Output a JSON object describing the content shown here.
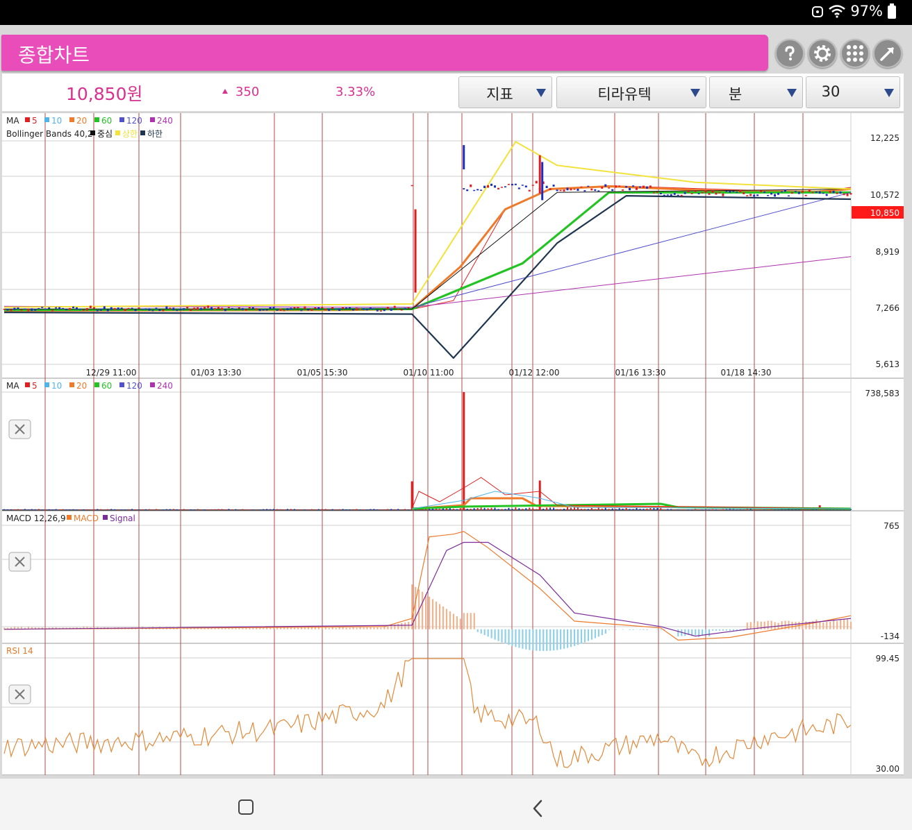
{
  "status_bar": {
    "battery": "97%"
  },
  "header": {
    "title": "종합차트"
  },
  "toolbar": {
    "help_icon": "question-circle-icon",
    "settings_icon": "gear-icon",
    "grid_icon": "grid-dots-icon",
    "expand_icon": "expand-arrow-icon"
  },
  "quote": {
    "price": "10,850원",
    "change": "350",
    "change_pct": "3.33%",
    "up_color": "#d9308f"
  },
  "dropdowns": {
    "indicator": "지표",
    "stock": "티라유텍",
    "period_unit": "분",
    "period_value": "30"
  },
  "colors": {
    "accent": "#e84db9",
    "up": "#e01e1e",
    "down": "#1b2fbf",
    "ma5": "#e02020",
    "ma10": "#4fb5e8",
    "ma20": "#ee7a2a",
    "ma60": "#22c322",
    "ma120": "#5050d0",
    "ma240": "#b030b0",
    "bb_mid": "#111111",
    "bb_upper": "#f2e23a",
    "bb_lower": "#1e3550",
    "macd": "#ee7a2a",
    "signal": "#7a2a9a",
    "rsi": "#e08a3a",
    "vline": "#b54a4a"
  },
  "legends": {
    "price_ma": {
      "label": "MA",
      "items": [
        "5",
        "10",
        "20",
        "60",
        "120",
        "240"
      ]
    },
    "bollinger": {
      "label": "Bollinger Bands 40,2",
      "items": [
        "중심",
        "상한",
        "하한"
      ]
    },
    "volume_ma": {
      "label": "MA",
      "items": [
        "5",
        "10",
        "20",
        "60",
        "120",
        "240"
      ]
    },
    "macd": {
      "label": "MACD 12,26,9",
      "items": [
        "MACD",
        "Signal"
      ]
    },
    "rsi": {
      "label": "RSI 14"
    }
  },
  "chart_data": [
    {
      "type": "candlestick",
      "panel": "price",
      "title": "",
      "x_ticks": [
        "12/29 11:00",
        "01/03 13:30",
        "01/05 15:30",
        "01/10 11:00",
        "01/12 12:00",
        "01/16 13:30",
        "01/18 14:30"
      ],
      "y_ticks": [
        "12,225",
        "10,572",
        "8,919",
        "7,266",
        "5,613"
      ],
      "ylim": [
        5613,
        12225
      ],
      "current_price_label": "10,850",
      "series": [
        {
          "name": "MA 5",
          "approx_path": [
            [
              0,
              7230
            ],
            [
              60,
              7220
            ],
            [
              118,
              7240
            ],
            [
              130,
              7500
            ],
            [
              145,
              10200
            ],
            [
              158,
              10800
            ],
            [
              175,
              10900
            ],
            [
              205,
              10800
            ],
            [
              235,
              10700
            ],
            [
              245,
              10850
            ]
          ]
        },
        {
          "name": "MA 20",
          "approx_path": [
            [
              0,
              7200
            ],
            [
              100,
              7220
            ],
            [
              118,
              7250
            ],
            [
              132,
              8500
            ],
            [
              145,
              10200
            ],
            [
              158,
              10800
            ],
            [
              175,
              10880
            ],
            [
              205,
              10750
            ],
            [
              235,
              10720
            ],
            [
              245,
              10800
            ]
          ]
        },
        {
          "name": "MA 60",
          "approx_path": [
            [
              0,
              7220
            ],
            [
              118,
              7250
            ],
            [
              150,
              8600
            ],
            [
              175,
              10700
            ],
            [
              205,
              10700
            ],
            [
              245,
              10700
            ]
          ]
        },
        {
          "name": "MA 120",
          "approx_path": [
            [
              0,
              7330
            ],
            [
              118,
              7300
            ],
            [
              245,
              10700
            ]
          ]
        },
        {
          "name": "MA 240",
          "approx_path": [
            [
              0,
              7330
            ],
            [
              118,
              7300
            ],
            [
              245,
              8800
            ]
          ]
        },
        {
          "name": "중심",
          "approx_path": [
            [
              0,
              7250
            ],
            [
              118,
              7250
            ],
            [
              160,
              10700
            ],
            [
              245,
              10800
            ]
          ]
        },
        {
          "name": "상한",
          "approx_path": [
            [
              0,
              7300
            ],
            [
              118,
              7400
            ],
            [
              148,
              12200
            ],
            [
              160,
              11500
            ],
            [
              200,
              11000
            ],
            [
              245,
              10800
            ]
          ]
        },
        {
          "name": "하한",
          "approx_path": [
            [
              0,
              7150
            ],
            [
              118,
              7100
            ],
            [
              130,
              5800
            ],
            [
              160,
              9200
            ],
            [
              180,
              10600
            ],
            [
              245,
              10500
            ]
          ]
        }
      ]
    },
    {
      "type": "bar",
      "panel": "volume",
      "y_ticks": [
        "738,583"
      ],
      "ylim": [
        0,
        738583
      ],
      "spikes": [
        [
          118,
          180000
        ],
        [
          133,
          738583
        ],
        [
          155,
          185000
        ],
        [
          236,
          30000
        ]
      ]
    },
    {
      "type": "line",
      "panel": "macd",
      "y_ticks": [
        "765",
        "-134"
      ],
      "ylim": [
        -134,
        765
      ],
      "series": [
        {
          "name": "MACD",
          "approx_path": [
            [
              0,
              0
            ],
            [
              110,
              20
            ],
            [
              118,
              80
            ],
            [
              123,
              680
            ],
            [
              130,
              700
            ],
            [
              133,
              720
            ],
            [
              140,
              600
            ],
            [
              155,
              300
            ],
            [
              165,
              60
            ],
            [
              190,
              10
            ],
            [
              195,
              -80
            ],
            [
              210,
              -60
            ],
            [
              235,
              50
            ],
            [
              245,
              100
            ]
          ]
        },
        {
          "name": "Signal",
          "approx_path": [
            [
              0,
              0
            ],
            [
              118,
              30
            ],
            [
              128,
              580
            ],
            [
              133,
              640
            ],
            [
              140,
              640
            ],
            [
              155,
              400
            ],
            [
              165,
              120
            ],
            [
              190,
              20
            ],
            [
              200,
              -50
            ],
            [
              215,
              0
            ],
            [
              245,
              80
            ]
          ]
        }
      ]
    },
    {
      "type": "line",
      "panel": "rsi",
      "y_ticks": [
        "99.45",
        "30.00"
      ],
      "ylim": [
        30,
        99.45
      ],
      "series": [
        {
          "name": "RSI 14",
          "approx_path": [
            [
              0,
              44
            ],
            [
              40,
              48
            ],
            [
              80,
              55
            ],
            [
              110,
              70
            ],
            [
              118,
              99
            ],
            [
              133,
              99
            ],
            [
              136,
              65
            ],
            [
              155,
              58
            ],
            [
              160,
              35
            ],
            [
              190,
              50
            ],
            [
              200,
              35
            ],
            [
              220,
              50
            ],
            [
              235,
              55
            ],
            [
              245,
              60
            ]
          ]
        }
      ]
    }
  ]
}
